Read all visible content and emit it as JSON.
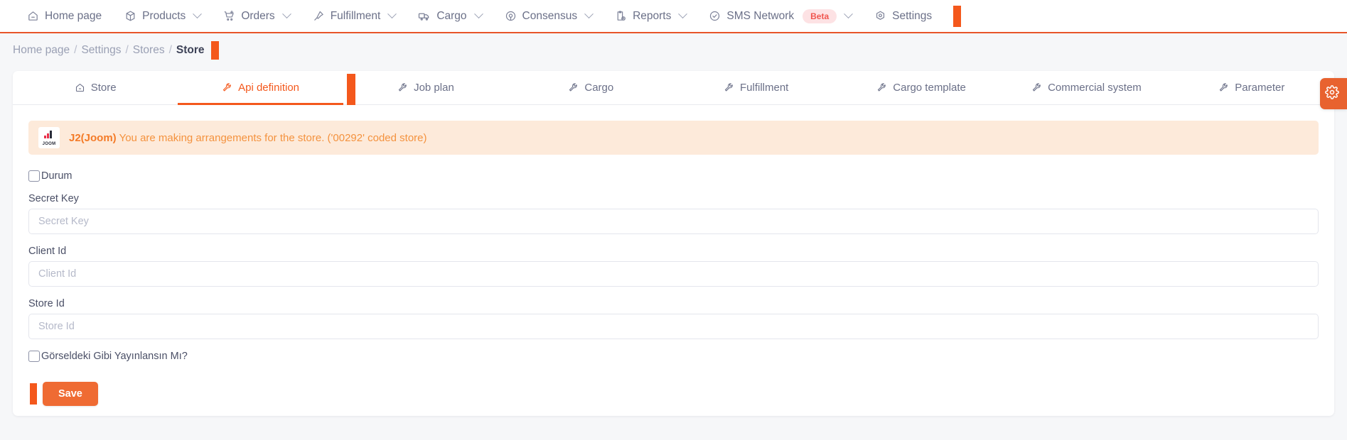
{
  "topnav": {
    "items": [
      {
        "label": "Home page",
        "icon": "home-icon",
        "caret": false
      },
      {
        "label": "Products",
        "icon": "box-icon",
        "caret": true
      },
      {
        "label": "Orders",
        "icon": "cart-plus-icon",
        "caret": true
      },
      {
        "label": "Fulfillment",
        "icon": "pin-icon",
        "caret": true
      },
      {
        "label": "Cargo",
        "icon": "truck-icon",
        "caret": true
      },
      {
        "label": "Consensus",
        "icon": "target-icon",
        "caret": true
      },
      {
        "label": "Reports",
        "icon": "clipboard-clock-icon",
        "caret": true
      },
      {
        "label": "SMS Network",
        "icon": "check-circle-icon",
        "caret": true,
        "badge": "Beta"
      },
      {
        "label": "Settings",
        "icon": "hexagon-gear-icon",
        "caret": false
      }
    ]
  },
  "breadcrumb": {
    "items": [
      "Home page",
      "Settings",
      "Stores"
    ],
    "current": "Store",
    "separator": "/"
  },
  "tabs": [
    {
      "label": "Store",
      "icon": "home-icon",
      "active": false
    },
    {
      "label": "Api definition",
      "icon": "wrench-icon",
      "active": true
    },
    {
      "label": "Job plan",
      "icon": "wrench-icon",
      "active": false
    },
    {
      "label": "Cargo",
      "icon": "wrench-icon",
      "active": false
    },
    {
      "label": "Fulfillment",
      "icon": "wrench-icon",
      "active": false
    },
    {
      "label": "Cargo template",
      "icon": "wrench-icon",
      "active": false
    },
    {
      "label": "Commercial system",
      "icon": "wrench-icon",
      "active": false
    },
    {
      "label": "Parameter",
      "icon": "wrench-icon",
      "active": false
    }
  ],
  "banner": {
    "logo_text": "JOOM",
    "strong": "J2(Joom)",
    "message": " You are making arrangements for the store. ('00292' coded store)"
  },
  "form": {
    "status_checkbox_label": "Durum",
    "fields": [
      {
        "label": "Secret Key",
        "placeholder": "Secret Key",
        "value": ""
      },
      {
        "label": "Client Id",
        "placeholder": "Client Id",
        "value": ""
      },
      {
        "label": "Store Id",
        "placeholder": "Store Id",
        "value": ""
      }
    ],
    "publish_checkbox_label": "Görseldeki Gibi Yayınlansın Mı?",
    "save_label": "Save"
  },
  "side_panel": {
    "icon": "gear-icon"
  },
  "colors": {
    "accent": "#f4581c",
    "save_button": "#ef6b33",
    "banner_bg": "#fdeada",
    "banner_text": "#f4923e",
    "beta_badge_bg": "#fde2e4",
    "beta_badge_text": "#f0564f",
    "page_bg": "#f6f7f9"
  }
}
